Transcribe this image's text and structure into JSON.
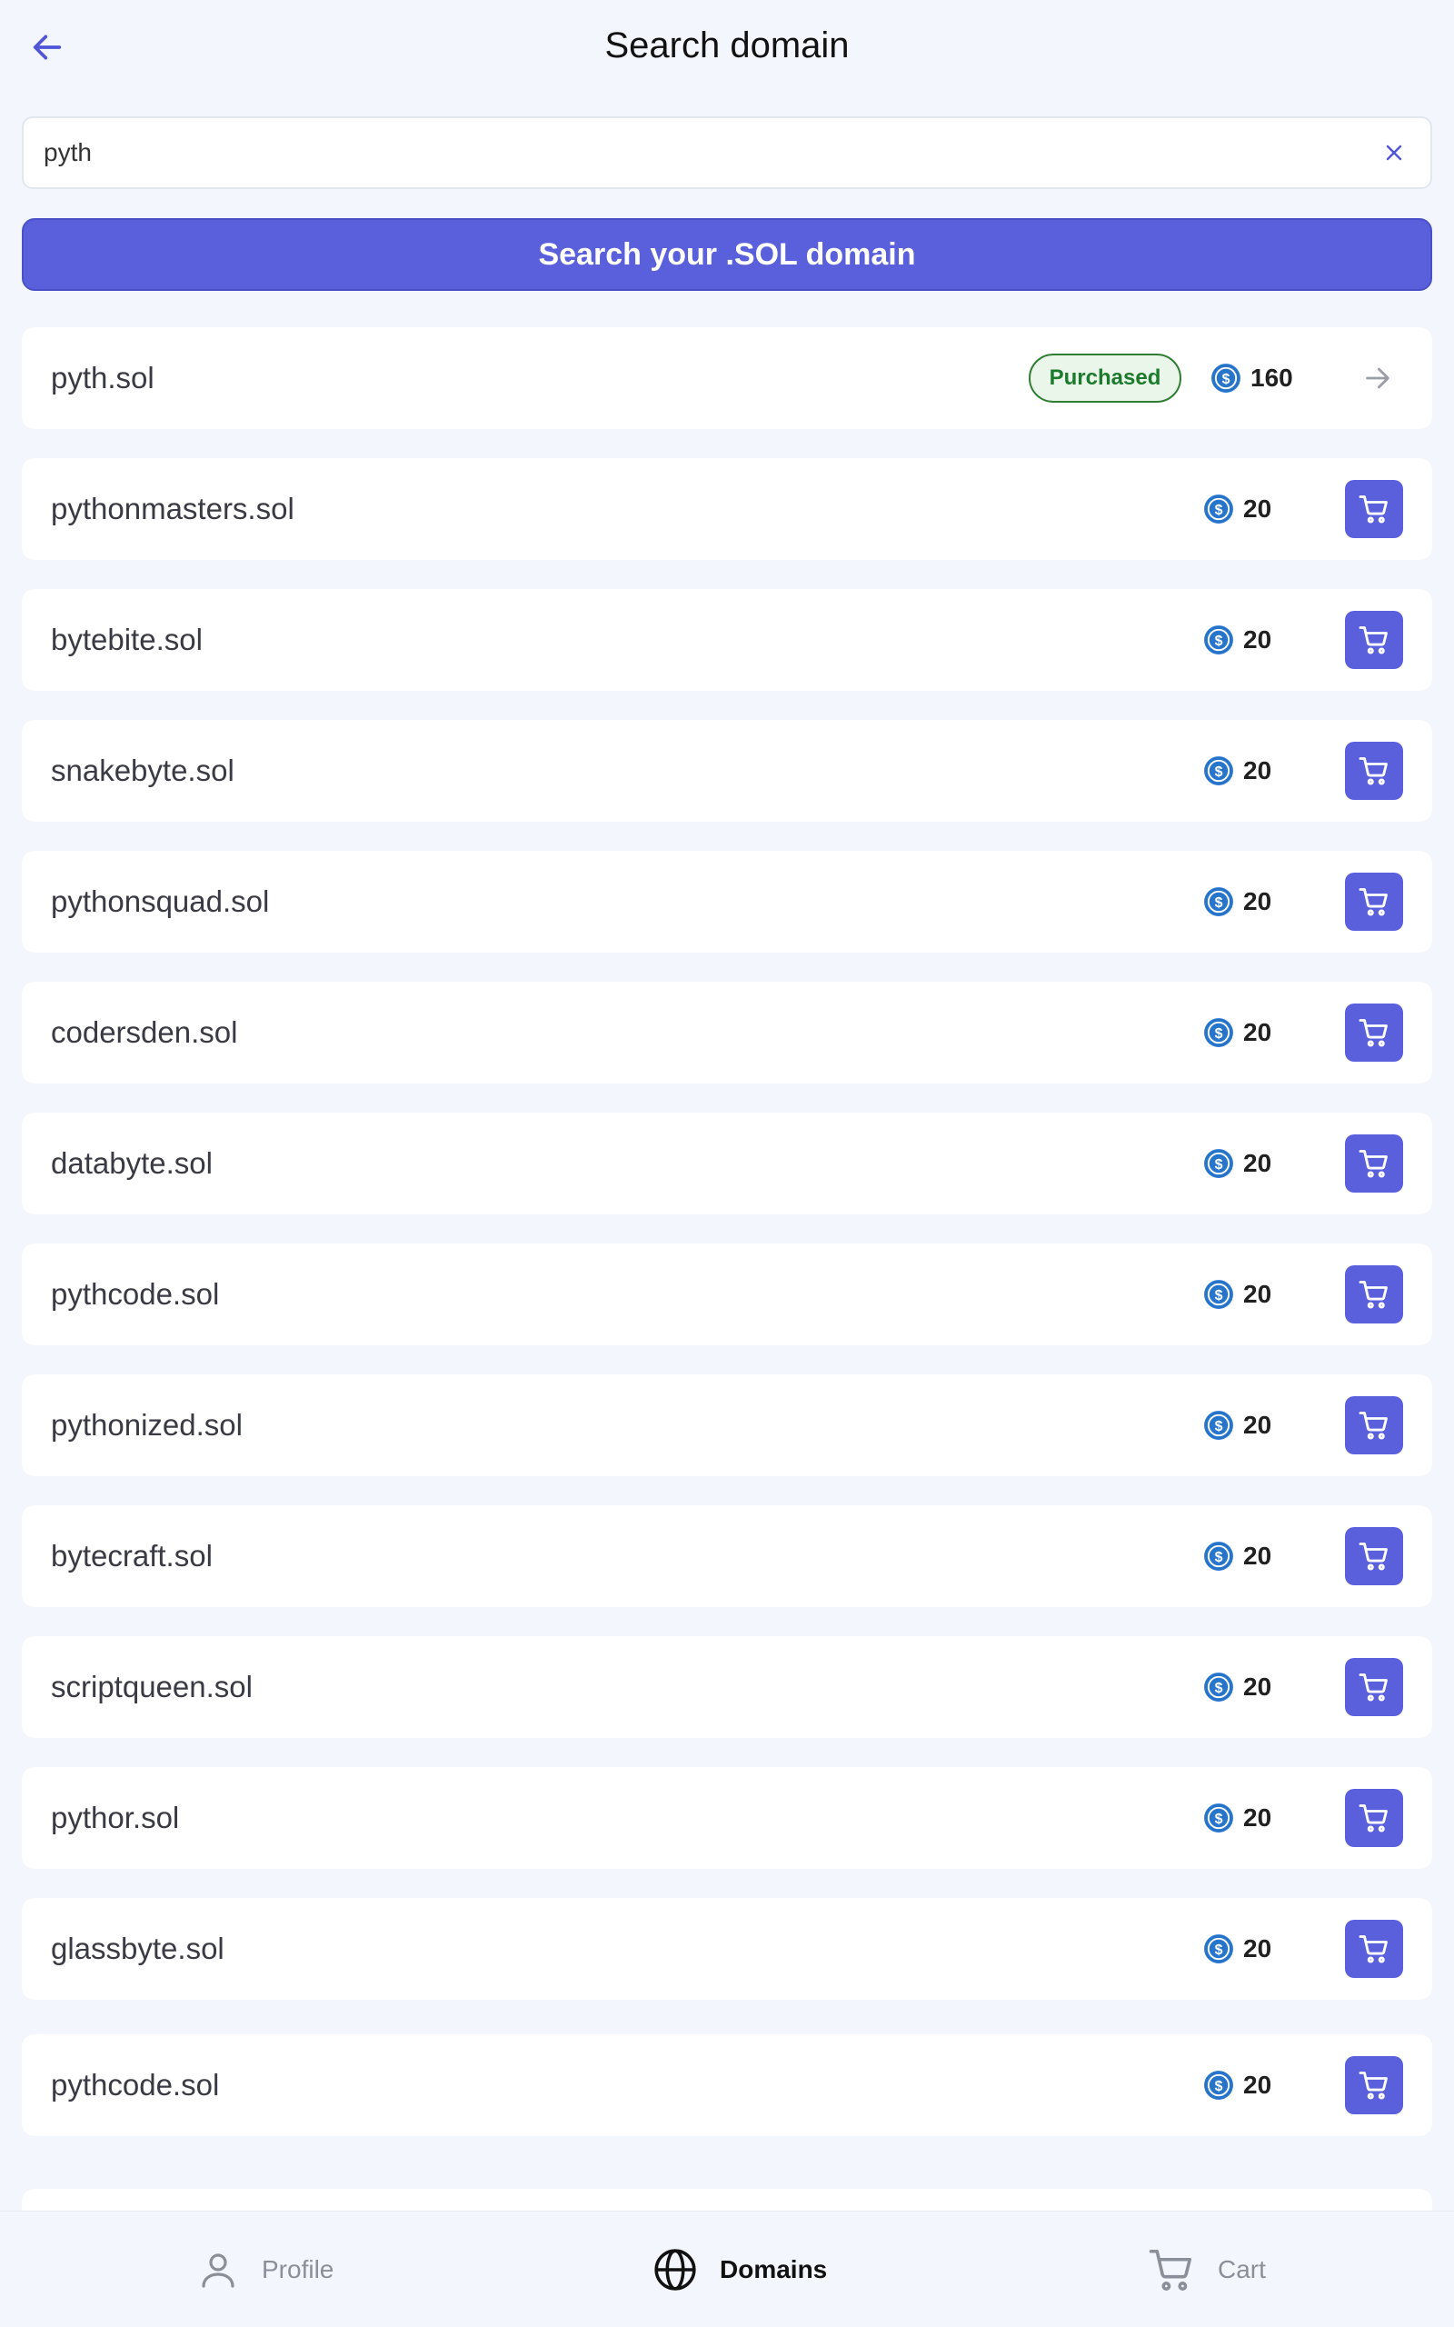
{
  "header": {
    "title": "Search domain",
    "back_icon": "arrow-left-icon"
  },
  "search": {
    "value": "pyth",
    "placeholder": "",
    "clear_icon": "close-icon"
  },
  "search_button": {
    "label": "Search your .SOL domain"
  },
  "colors": {
    "accent": "#5a5fdb",
    "purchased_green": "#1b7a2b",
    "coin_blue": "#2775ca",
    "background": "#f3f6fc"
  },
  "domains": [
    {
      "name": "pyth.sol",
      "price": "160",
      "status": "Purchased"
    },
    {
      "name": "pythonmasters.sol",
      "price": "20"
    },
    {
      "name": "bytebite.sol",
      "price": "20"
    },
    {
      "name": "snakebyte.sol",
      "price": "20"
    },
    {
      "name": "pythonsquad.sol",
      "price": "20"
    },
    {
      "name": "codersden.sol",
      "price": "20"
    },
    {
      "name": "databyte.sol",
      "price": "20"
    },
    {
      "name": "pythcode.sol",
      "price": "20"
    },
    {
      "name": "pythonized.sol",
      "price": "20"
    },
    {
      "name": "bytecraft.sol",
      "price": "20"
    },
    {
      "name": "scriptqueen.sol",
      "price": "20"
    },
    {
      "name": "pythor.sol",
      "price": "20"
    },
    {
      "name": "glassbyte.sol",
      "price": "20"
    },
    {
      "name": "pythcode.sol",
      "price": "20"
    }
  ],
  "bottom_nav": {
    "items": [
      {
        "label": "Profile",
        "icon": "user-icon",
        "active": false
      },
      {
        "label": "Domains",
        "icon": "globe-icon",
        "active": true
      },
      {
        "label": "Cart",
        "icon": "cart-icon",
        "active": false
      }
    ]
  }
}
